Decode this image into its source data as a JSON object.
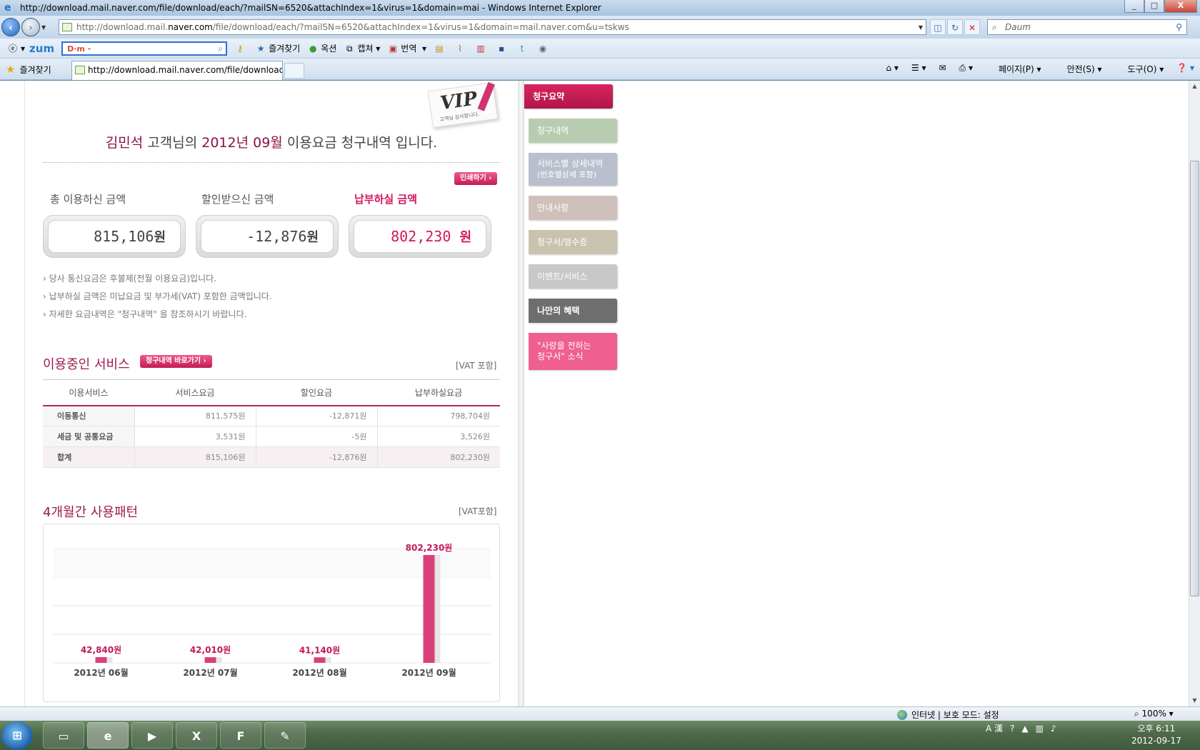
{
  "window": {
    "title": "http://download.mail.naver.com/file/download/each/?mailSN=6520&attachIndex=1&virus=1&domain=mai - Windows Internet Explorer",
    "controls": [
      "_",
      "□",
      "X"
    ]
  },
  "nav": {
    "url_pre": "http://download.mail.",
    "url_host": "naver.com",
    "url_post": "/file/download/each/?mailSN=6520&attachIndex=1&virus=1&domain=mail.naver.com&u=tskws",
    "search_placeholder": "Daum"
  },
  "toolbar": {
    "zum": "zum",
    "daum_logo": "D·m",
    "daum_value": "-",
    "favorites": "즐겨찾기",
    "auction": "옥션",
    "capture": "캡쳐",
    "translate": "번역"
  },
  "tabbar": {
    "favorites": "즐겨찾기",
    "tab_title": "http://download.mail.naver.com/file/download/...",
    "page_menu": "페이지(P)",
    "safety_menu": "안전(S)",
    "tools_menu": "도구(O)"
  },
  "bill": {
    "vip_title": "VIP",
    "vip_sub": "고객님 감사합니다.",
    "customer_name": "김민석",
    "headline_mid": "고객님의",
    "period": "2012년 09월",
    "headline_end": "이용요금 청구내역 입니다.",
    "print_button": "인쇄하기 ›",
    "total_label": "총 이용하신 금액",
    "discount_label": "할인받으신 금액",
    "pay_label": "납부하실 금액",
    "total_value": "815,106",
    "discount_value": "-12,876",
    "pay_value": "802,230",
    "unit": "원",
    "notes": [
      "› 당사 통신요금은 후불제(전월 이용요금)입니다.",
      "› 납부하실 금액은 미납요금 및 부가세(VAT) 포함한 금액입니다.",
      "› 자세한 요금내역은 \"청구내역\" 을 참조하시기 바랍니다."
    ]
  },
  "services": {
    "title": "이용중인 서비스",
    "button": "청구내역 바로가기 ›",
    "vat": "[VAT 포함]",
    "columns": [
      "이용서비스",
      "서비스요금",
      "할인요금",
      "납부하실요금"
    ],
    "rows": [
      [
        "이동통신",
        "811,575원",
        "-12,871원",
        "798,704원"
      ],
      [
        "세금 및 공통요금",
        "3,531원",
        "-5원",
        "3,526원"
      ],
      [
        "합계",
        "815,106원",
        "-12,876원",
        "802,230원"
      ]
    ]
  },
  "usage": {
    "title": "4개월간 사용패턴",
    "vat": "[VAT포함]"
  },
  "chart_data": {
    "type": "bar",
    "categories": [
      "2012년 06월",
      "2012년 07월",
      "2012년 08월",
      "2012년 09월"
    ],
    "values": [
      42840,
      42010,
      41140,
      802230
    ],
    "value_labels": [
      "42,840원",
      "42,010원",
      "41,140원",
      "802,230원"
    ],
    "title": "4개월간 사용패턴",
    "ylim": [
      0,
      850000
    ],
    "grid": true,
    "bar_color": "#d9407b",
    "shadow_color": "#e5e5e5"
  },
  "menu": {
    "items": [
      {
        "label": "청구요약",
        "color": "#c41b54",
        "active": true
      },
      {
        "label": "청구내역",
        "color": "#b8cdb0"
      },
      {
        "label": "서비스별 상세내역",
        "sub": "(번호별상세 포함)",
        "color": "#b9bfcc"
      },
      {
        "label": "안내사항",
        "color": "#cfc0bc"
      },
      {
        "label": "청구서/영수증",
        "color": "#c9c2ae"
      },
      {
        "label": "이벤트/서비스",
        "color": "#c8c8c8"
      },
      {
        "label": "나만의 혜택",
        "color": "#6e6e6e"
      },
      {
        "label": "\"사랑을 전하는",
        "sub": " 청구서\" 소식",
        "color": "#ef5f90"
      }
    ]
  },
  "status": {
    "zone": "인터넷 | 보호 모드: 설정",
    "zoom": "100%"
  },
  "taskbar": {
    "start": "⊞",
    "time": "오후 6:11",
    "date": "2012-09-17",
    "ime": "A 漢"
  }
}
